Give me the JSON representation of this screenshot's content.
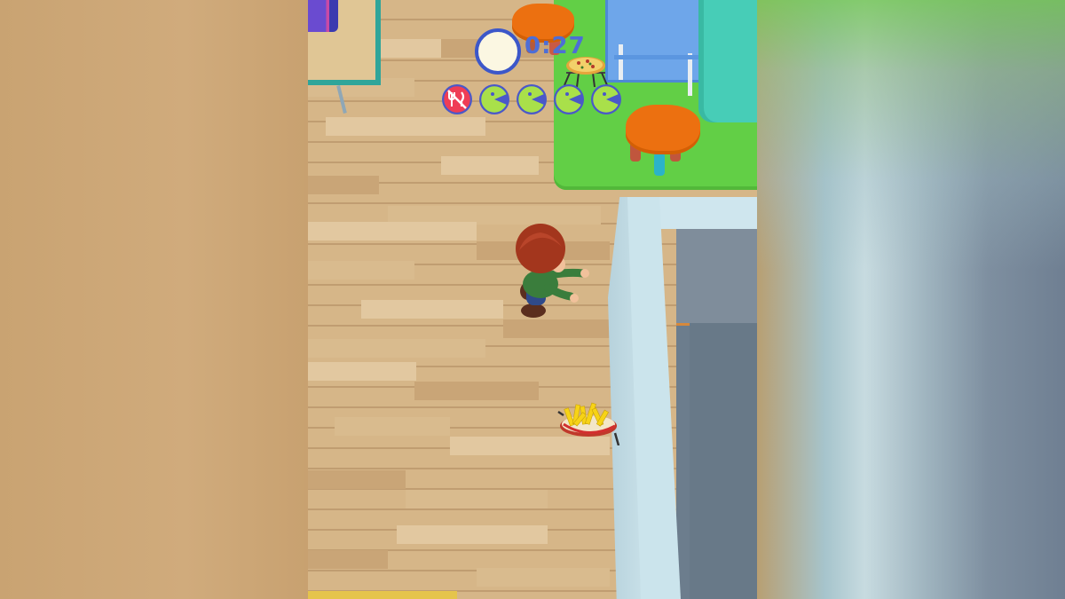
{
  "hud": {
    "timer": "0:27",
    "timer_progress": 1.0,
    "lives": [
      {
        "icon": "crossed-fork-knife-icon",
        "state": "lost"
      },
      {
        "icon": "pacman-icon",
        "state": "remaining"
      },
      {
        "icon": "pacman-icon",
        "state": "remaining"
      },
      {
        "icon": "pacman-icon",
        "state": "remaining"
      },
      {
        "icon": "pacman-icon",
        "state": "remaining"
      }
    ]
  },
  "scene": {
    "player": "boy-character",
    "items": [
      "french-fries-basket",
      "pizza-on-stand"
    ],
    "furniture": [
      "bookshelf",
      "blue-table",
      "teal-sofa",
      "orange-stool",
      "orange-stool"
    ]
  },
  "colors": {
    "floor": "#d6b688",
    "carpet": "#62cf46",
    "timer_ring": "#3c57c9",
    "timer_text": "#4d6ed6",
    "life_icon": "#a9e04a",
    "lost_icon": "#ef3d55"
  }
}
